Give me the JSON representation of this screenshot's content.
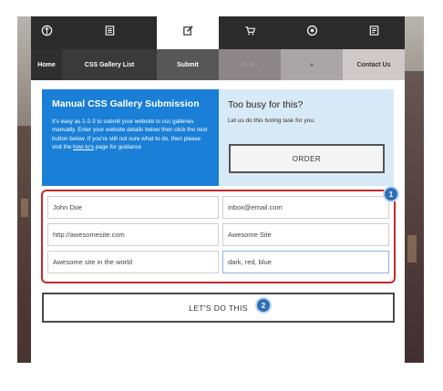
{
  "icons": [
    {
      "name": "compass-icon",
      "active": false
    },
    {
      "name": "list-icon",
      "active": false
    },
    {
      "name": "edit-icon",
      "active": true
    },
    {
      "name": "cart-icon",
      "active": false
    },
    {
      "name": "target-icon",
      "active": false
    },
    {
      "name": "contact-card-icon",
      "active": false
    }
  ],
  "nav": {
    "home": "Home",
    "css_gallery": "CSS Gallery List",
    "submit": "Submit",
    "order": "Order",
    "rss": "»",
    "contact": "Contact Us"
  },
  "intro": {
    "title": "Manual CSS Gallery Submission",
    "text_before_link": "It's easy as 1-2-3 to submit your website to css galleries manually. Enter your website details below then click the next button below. If you're still not sure what to do, then please visit the ",
    "link": "how to's",
    "text_after_link": " page for guidance"
  },
  "busy": {
    "title": "Too busy for this?",
    "text": "Let us do this boring task for you.",
    "order_button": "ORDER"
  },
  "form": {
    "name": "John Doe",
    "email": "inbox@email.com",
    "url": "http://awesomesite.com",
    "site_name": "Awesome Site",
    "description": "Awesome site in the world",
    "colors": "dark, red, blue"
  },
  "badges": {
    "one": "1",
    "two": "2"
  },
  "submit_button": "LET'S DO THIS",
  "colors": {
    "accent_blue": "#1a7fd6",
    "highlight_red": "#c62828",
    "nav_dark": "#2b2b2b"
  }
}
